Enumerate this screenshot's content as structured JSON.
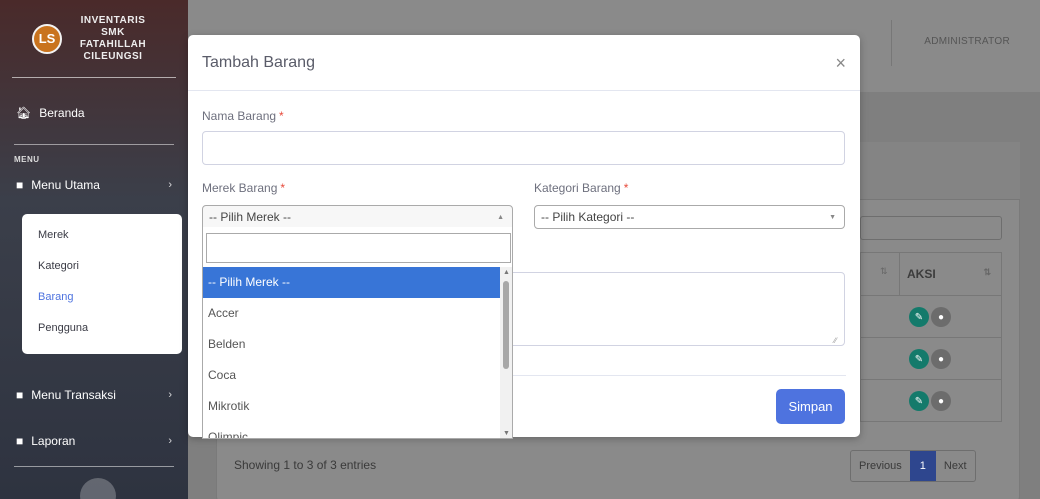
{
  "sidebar": {
    "brand_line1": "INVENTARIS",
    "brand_line2": "SMK FATAHILLAH",
    "brand_line3": "CILEUNGSI",
    "logo_text": "LS",
    "beranda": "Beranda",
    "heading": "MENU",
    "menu_utama": "Menu Utama",
    "submenu": [
      "Merek",
      "Kategori",
      "Barang",
      "Pengguna"
    ],
    "menu_transaksi": "Menu Transaksi",
    "laporan": "Laporan"
  },
  "topbar": {
    "user": "ADMINISTRATOR"
  },
  "table": {
    "aksi_header": "AKSI",
    "showing": "Showing 1 to 3 of 3 entries",
    "pager": {
      "previous": "Previous",
      "page": "1",
      "next": "Next"
    }
  },
  "modal": {
    "title": "Tambah Barang",
    "close": "×",
    "nama_label": "Nama Barang",
    "merek_label": "Merek Barang",
    "kategori_label": "Kategori Barang",
    "required_mark": "*",
    "merek_selected": "-- Pilih Merek --",
    "kategori_selected": "-- Pilih Kategori --",
    "save": "Simpan"
  },
  "dropdown": {
    "options": [
      "-- Pilih Merek --",
      "Accer",
      "Belden",
      "Coca",
      "Mikrotik",
      "Olimpic"
    ],
    "selected_index": 0
  },
  "colors": {
    "primary": "#4e73df",
    "highlight": "#3875d7",
    "required": "#e74a3b",
    "edit": "#1cc88a"
  }
}
